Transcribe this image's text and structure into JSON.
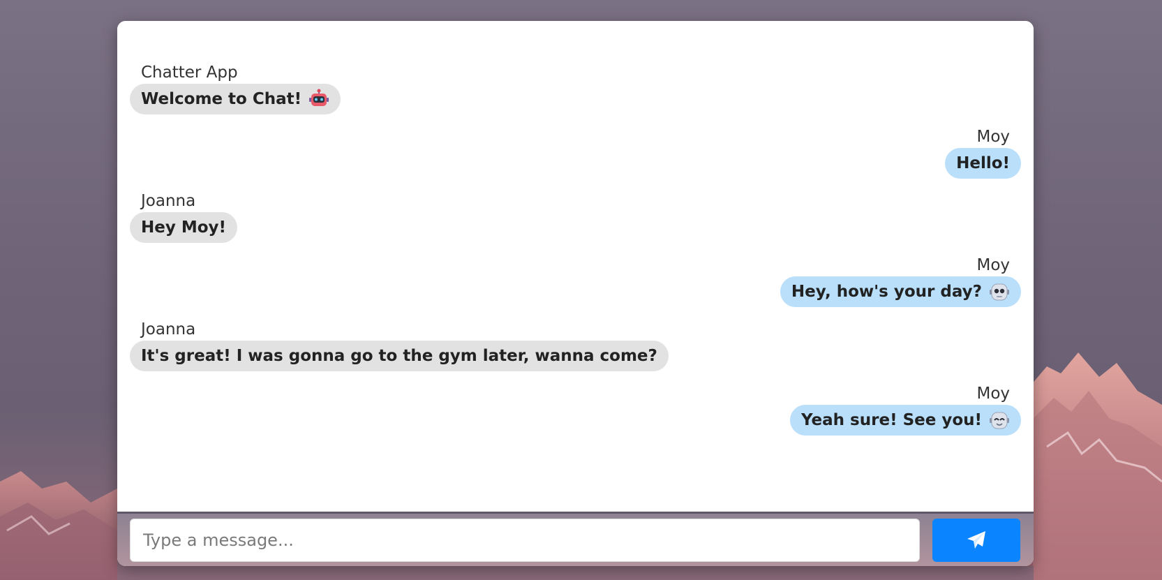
{
  "app": {
    "title": "Chatter App"
  },
  "colors": {
    "incoming_bubble": "#e2e2e2",
    "outgoing_bubble": "#b9dffb",
    "send_button": "#0a84ff"
  },
  "messages": [
    {
      "sender": "Chatter App",
      "text": "Welcome to Chat!",
      "side": "left",
      "emoji": "robot-face-icon"
    },
    {
      "sender": "Moy",
      "text": "Hello!",
      "side": "right",
      "emoji": ""
    },
    {
      "sender": "Joanna",
      "text": "Hey Moy!",
      "side": "left",
      "emoji": ""
    },
    {
      "sender": "Moy",
      "text": "Hey, how's your day?",
      "side": "right",
      "emoji": "robot-face-icon"
    },
    {
      "sender": "Joanna",
      "text": "It's great! I was gonna go to the gym later, wanna come?",
      "side": "left",
      "emoji": ""
    },
    {
      "sender": "Moy",
      "text": "Yeah sure! See you!",
      "side": "right",
      "emoji": "robot-face-icon"
    }
  ],
  "composer": {
    "placeholder": "Type a message...",
    "value": "",
    "send_icon": "paper-plane-icon"
  }
}
